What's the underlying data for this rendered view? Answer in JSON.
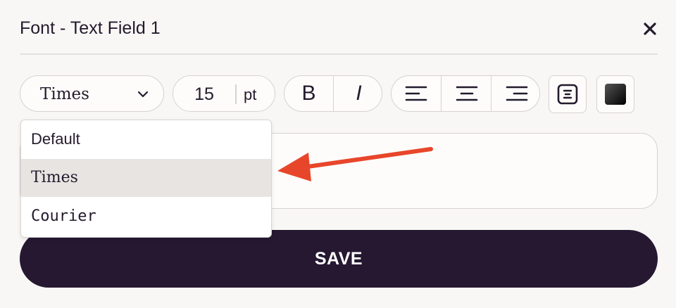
{
  "dialog": {
    "title": "Font - Text Field 1"
  },
  "toolbar": {
    "font_family_selected": "Times",
    "font_size": "15",
    "font_size_unit": "pt",
    "bold_label": "B",
    "italic_label": "I",
    "text_color": "#000000"
  },
  "font_dropdown": {
    "options": [
      {
        "label": "Default",
        "selected": false
      },
      {
        "label": "Times",
        "selected": true
      },
      {
        "label": "Courier",
        "selected": false
      }
    ]
  },
  "save_button": {
    "label": "SAVE"
  },
  "colors": {
    "primary": "#251830",
    "annotation_arrow": "#e8462b"
  },
  "icons": [
    "close-icon",
    "chevron-down-icon",
    "align-left-icon",
    "align-center-icon",
    "align-right-icon",
    "vertical-align-icon",
    "color-swatch-icon",
    "annotation-arrow-icon"
  ]
}
